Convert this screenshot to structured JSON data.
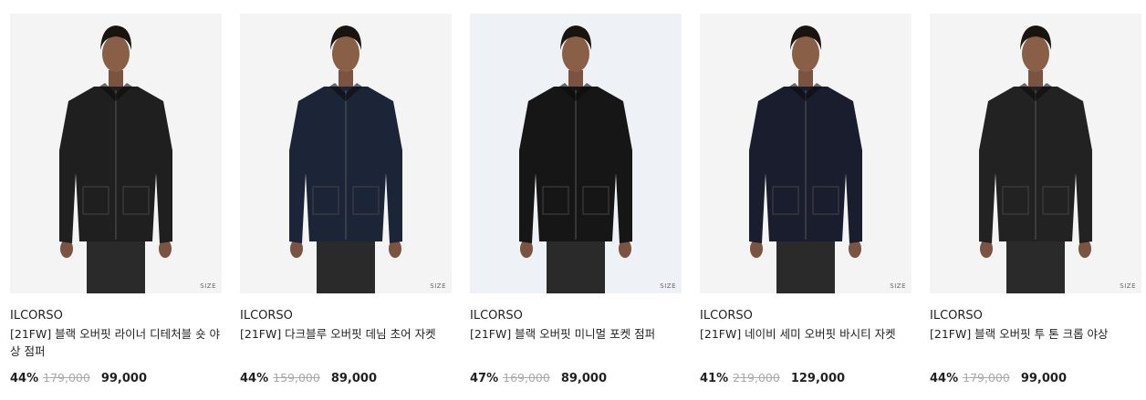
{
  "products": [
    {
      "brand": "ILCORSO",
      "title": "[21FW] 블랙 오버핏 라이너 디테처블 숏 야상 점퍼",
      "discount": "44%",
      "original_price": "179,000",
      "sale_price": "99,000",
      "size_label": "SIZE",
      "jacket_color": "#1f1f1f",
      "image_alt": false
    },
    {
      "brand": "ILCORSO",
      "title": "[21FW] 다크블루 오버핏 데님 초어 자켓",
      "discount": "44%",
      "original_price": "159,000",
      "sale_price": "89,000",
      "size_label": "SIZE",
      "jacket_color": "#1c2537",
      "image_alt": false
    },
    {
      "brand": "ILCORSO",
      "title": "[21FW] 블랙 오버핏 미니멀 포켓 점퍼",
      "discount": "47%",
      "original_price": "169,000",
      "sale_price": "89,000",
      "size_label": "SIZE",
      "jacket_color": "#161616",
      "image_alt": true
    },
    {
      "brand": "ILCORSO",
      "title": "[21FW] 네이비 세미 오버핏 바시티 자켓",
      "discount": "41%",
      "original_price": "219,000",
      "sale_price": "129,000",
      "size_label": "SIZE",
      "jacket_color": "#1a1d2e",
      "image_alt": false
    },
    {
      "brand": "ILCORSO",
      "title": "[21FW] 블랙 오버핏 투 톤 크롭 야상",
      "discount": "44%",
      "original_price": "179,000",
      "sale_price": "99,000",
      "size_label": "SIZE",
      "jacket_color": "#222222",
      "image_alt": false
    }
  ]
}
